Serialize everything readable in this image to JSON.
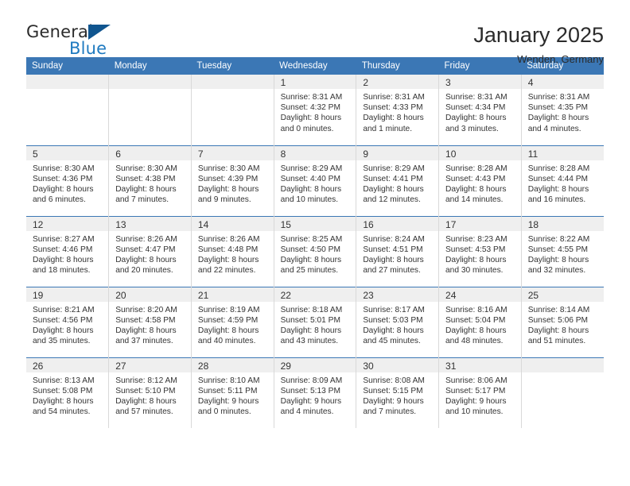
{
  "brand": {
    "name_part1": "General",
    "name_part2": "Blue",
    "accent_color": "#1f7ac0",
    "triangle_color": "#10558f",
    "triangle_icon": "triangle-icon"
  },
  "header": {
    "title": "January 2025",
    "subtitle": "Wenden, Germany"
  },
  "theme": {
    "header_bar": "#3b77b5",
    "daynum_band": "#efefef",
    "text": "#333333"
  },
  "weekday_headers": [
    "Sunday",
    "Monday",
    "Tuesday",
    "Wednesday",
    "Thursday",
    "Friday",
    "Saturday"
  ],
  "labels": {
    "sunrise_prefix": "Sunrise:",
    "sunset_prefix": "Sunset:",
    "daylight_prefix": "Daylight:"
  },
  "weeks": [
    [
      {
        "day": "",
        "empty": true
      },
      {
        "day": "",
        "empty": true
      },
      {
        "day": "",
        "empty": true
      },
      {
        "day": "1",
        "sunrise": "Sunrise: 8:31 AM",
        "sunset": "Sunset: 4:32 PM",
        "daylight": "Daylight: 8 hours and 0 minutes."
      },
      {
        "day": "2",
        "sunrise": "Sunrise: 8:31 AM",
        "sunset": "Sunset: 4:33 PM",
        "daylight": "Daylight: 8 hours and 1 minute."
      },
      {
        "day": "3",
        "sunrise": "Sunrise: 8:31 AM",
        "sunset": "Sunset: 4:34 PM",
        "daylight": "Daylight: 8 hours and 3 minutes."
      },
      {
        "day": "4",
        "sunrise": "Sunrise: 8:31 AM",
        "sunset": "Sunset: 4:35 PM",
        "daylight": "Daylight: 8 hours and 4 minutes."
      }
    ],
    [
      {
        "day": "5",
        "sunrise": "Sunrise: 8:30 AM",
        "sunset": "Sunset: 4:36 PM",
        "daylight": "Daylight: 8 hours and 6 minutes."
      },
      {
        "day": "6",
        "sunrise": "Sunrise: 8:30 AM",
        "sunset": "Sunset: 4:38 PM",
        "daylight": "Daylight: 8 hours and 7 minutes."
      },
      {
        "day": "7",
        "sunrise": "Sunrise: 8:30 AM",
        "sunset": "Sunset: 4:39 PM",
        "daylight": "Daylight: 8 hours and 9 minutes."
      },
      {
        "day": "8",
        "sunrise": "Sunrise: 8:29 AM",
        "sunset": "Sunset: 4:40 PM",
        "daylight": "Daylight: 8 hours and 10 minutes."
      },
      {
        "day": "9",
        "sunrise": "Sunrise: 8:29 AM",
        "sunset": "Sunset: 4:41 PM",
        "daylight": "Daylight: 8 hours and 12 minutes."
      },
      {
        "day": "10",
        "sunrise": "Sunrise: 8:28 AM",
        "sunset": "Sunset: 4:43 PM",
        "daylight": "Daylight: 8 hours and 14 minutes."
      },
      {
        "day": "11",
        "sunrise": "Sunrise: 8:28 AM",
        "sunset": "Sunset: 4:44 PM",
        "daylight": "Daylight: 8 hours and 16 minutes."
      }
    ],
    [
      {
        "day": "12",
        "sunrise": "Sunrise: 8:27 AM",
        "sunset": "Sunset: 4:46 PM",
        "daylight": "Daylight: 8 hours and 18 minutes."
      },
      {
        "day": "13",
        "sunrise": "Sunrise: 8:26 AM",
        "sunset": "Sunset: 4:47 PM",
        "daylight": "Daylight: 8 hours and 20 minutes."
      },
      {
        "day": "14",
        "sunrise": "Sunrise: 8:26 AM",
        "sunset": "Sunset: 4:48 PM",
        "daylight": "Daylight: 8 hours and 22 minutes."
      },
      {
        "day": "15",
        "sunrise": "Sunrise: 8:25 AM",
        "sunset": "Sunset: 4:50 PM",
        "daylight": "Daylight: 8 hours and 25 minutes."
      },
      {
        "day": "16",
        "sunrise": "Sunrise: 8:24 AM",
        "sunset": "Sunset: 4:51 PM",
        "daylight": "Daylight: 8 hours and 27 minutes."
      },
      {
        "day": "17",
        "sunrise": "Sunrise: 8:23 AM",
        "sunset": "Sunset: 4:53 PM",
        "daylight": "Daylight: 8 hours and 30 minutes."
      },
      {
        "day": "18",
        "sunrise": "Sunrise: 8:22 AM",
        "sunset": "Sunset: 4:55 PM",
        "daylight": "Daylight: 8 hours and 32 minutes."
      }
    ],
    [
      {
        "day": "19",
        "sunrise": "Sunrise: 8:21 AM",
        "sunset": "Sunset: 4:56 PM",
        "daylight": "Daylight: 8 hours and 35 minutes."
      },
      {
        "day": "20",
        "sunrise": "Sunrise: 8:20 AM",
        "sunset": "Sunset: 4:58 PM",
        "daylight": "Daylight: 8 hours and 37 minutes."
      },
      {
        "day": "21",
        "sunrise": "Sunrise: 8:19 AM",
        "sunset": "Sunset: 4:59 PM",
        "daylight": "Daylight: 8 hours and 40 minutes."
      },
      {
        "day": "22",
        "sunrise": "Sunrise: 8:18 AM",
        "sunset": "Sunset: 5:01 PM",
        "daylight": "Daylight: 8 hours and 43 minutes."
      },
      {
        "day": "23",
        "sunrise": "Sunrise: 8:17 AM",
        "sunset": "Sunset: 5:03 PM",
        "daylight": "Daylight: 8 hours and 45 minutes."
      },
      {
        "day": "24",
        "sunrise": "Sunrise: 8:16 AM",
        "sunset": "Sunset: 5:04 PM",
        "daylight": "Daylight: 8 hours and 48 minutes."
      },
      {
        "day": "25",
        "sunrise": "Sunrise: 8:14 AM",
        "sunset": "Sunset: 5:06 PM",
        "daylight": "Daylight: 8 hours and 51 minutes."
      }
    ],
    [
      {
        "day": "26",
        "sunrise": "Sunrise: 8:13 AM",
        "sunset": "Sunset: 5:08 PM",
        "daylight": "Daylight: 8 hours and 54 minutes."
      },
      {
        "day": "27",
        "sunrise": "Sunrise: 8:12 AM",
        "sunset": "Sunset: 5:10 PM",
        "daylight": "Daylight: 8 hours and 57 minutes."
      },
      {
        "day": "28",
        "sunrise": "Sunrise: 8:10 AM",
        "sunset": "Sunset: 5:11 PM",
        "daylight": "Daylight: 9 hours and 0 minutes."
      },
      {
        "day": "29",
        "sunrise": "Sunrise: 8:09 AM",
        "sunset": "Sunset: 5:13 PM",
        "daylight": "Daylight: 9 hours and 4 minutes."
      },
      {
        "day": "30",
        "sunrise": "Sunrise: 8:08 AM",
        "sunset": "Sunset: 5:15 PM",
        "daylight": "Daylight: 9 hours and 7 minutes."
      },
      {
        "day": "31",
        "sunrise": "Sunrise: 8:06 AM",
        "sunset": "Sunset: 5:17 PM",
        "daylight": "Daylight: 9 hours and 10 minutes."
      },
      {
        "day": "",
        "empty": true
      }
    ]
  ]
}
